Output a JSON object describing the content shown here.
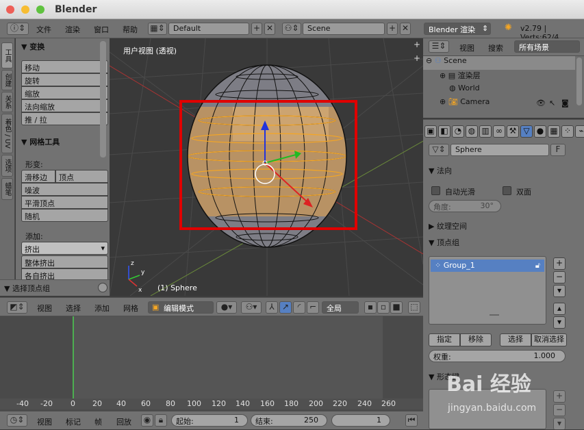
{
  "window": {
    "title": "Blender"
  },
  "info_header": {
    "menus": [
      "文件",
      "渲染",
      "窗口",
      "帮助"
    ],
    "layout": "Default",
    "scene": "Scene",
    "engine": "Blender 渲染",
    "version_stats": "v2.79 | Verts:62/4"
  },
  "tool_shelf": {
    "tabs": [
      "工具",
      "创建",
      "关系",
      "着色 / UV",
      "选项",
      "蜡笔"
    ],
    "transform": {
      "title": "变换",
      "buttons": [
        "移动",
        "旋转",
        "缩放",
        "法向缩放",
        "推 / 拉"
      ]
    },
    "mesh_tools": {
      "title": "网格工具",
      "deform_label": "形变:",
      "slide_edge": "滑移边",
      "vertex": "顶点",
      "buttons": [
        "噪波",
        "平滑顶点",
        "随机"
      ],
      "add_label": "添加:",
      "extrude": "挤出",
      "extrude_buttons": [
        "整体挤出",
        "各自挤出"
      ]
    },
    "last_op": "选择顶点组"
  },
  "viewport": {
    "title": "用户视图 (透视)",
    "object_label": "(1) Sphere"
  },
  "header_3d": {
    "menus": [
      "视图",
      "选择",
      "添加",
      "网格"
    ],
    "mode": "编辑模式",
    "pivot": "全局"
  },
  "timeline": {
    "ticks": [
      "-40",
      "-20",
      "0",
      "20",
      "40",
      "60",
      "80",
      "100",
      "120",
      "140",
      "160",
      "180",
      "200",
      "220",
      "240",
      "260"
    ],
    "menus": [
      "视图",
      "标记",
      "帧",
      "回放"
    ],
    "start_label": "起始:",
    "start_value": "1",
    "end_label": "结束:",
    "end_value": "250",
    "current_frame": "1"
  },
  "outliner": {
    "menus": [
      "视图",
      "搜索"
    ],
    "filter": "所有场景",
    "items": [
      "Scene",
      "渲染层",
      "World",
      "Camera"
    ]
  },
  "properties": {
    "mesh_name": "Sphere",
    "fake_user": "F",
    "normals": {
      "title": "法向",
      "auto_smooth": "自动光滑",
      "double_sided": "双面",
      "angle_label": "角度:",
      "angle_value": "30°"
    },
    "texture_space": "纹理空间",
    "vertex_groups": {
      "title": "顶点组",
      "items": [
        "Group_1"
      ],
      "assign": "指定",
      "remove": "移除",
      "select": "选择",
      "deselect": "取消选择",
      "weight_label": "权重:",
      "weight_value": "1.000"
    },
    "shape_keys": "形态键"
  },
  "watermark": {
    "brand": "Bai 经验",
    "url": "jingyan.baidu.com"
  },
  "colors": {
    "accent_blue": "#5680c2",
    "selection_orange": "#f5a623",
    "highlight_red": "#e00000",
    "frame_green": "#4caf50"
  }
}
